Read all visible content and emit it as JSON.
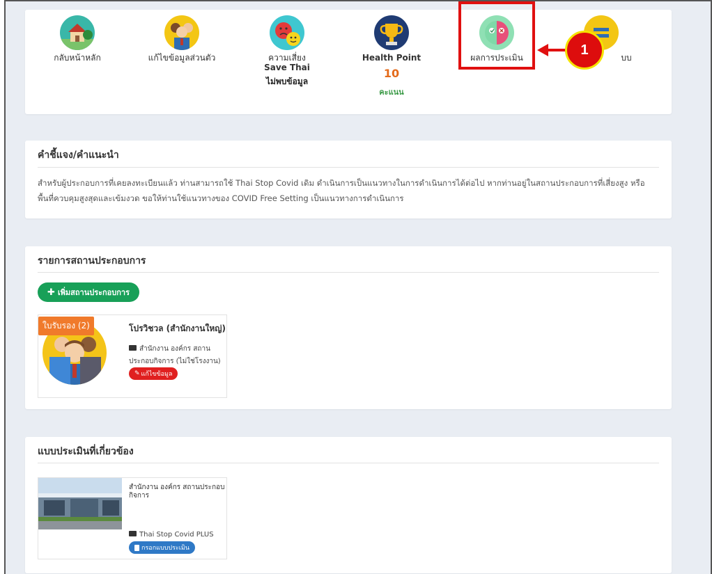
{
  "menu": {
    "home": "กลับหน้าหลัก",
    "profile": "แก้ไขข้อมูลส่วนตัว",
    "risk_line1": "ความเสี่ยง",
    "risk_line2": "Save Thai",
    "risk_status": "ไม่พบข้อมูล",
    "health_label": "Health Point",
    "health_score": "10",
    "health_unit": "คะแนน",
    "results": "ผลการประเมิน",
    "logout_partial": "บบ"
  },
  "callout": {
    "number": "1"
  },
  "guide": {
    "title": "คำชี้แจง/คำแนะนำ",
    "body": "สำหรับผู้ประกอบการที่เคยลงทะเบียนแล้ว ท่านสามารถใช้ Thai Stop Covid เดิม ดำเนินการเป็นแนวทางในการดำเนินการได้ต่อไป หากท่านอยู่ในสถานประกอบการที่เสี่ยงสูง หรือ พื้นที่ควบคุมสูงสุดและเข้มงวด ขอให้ท่านใช้แนวทางของ COVID Free Setting เป็นแนวทางการดำเนินการ"
  },
  "business": {
    "title": "รายการสถานประกอบการ",
    "add_label": "เพิ่มสถานประกอบการ",
    "card": {
      "cert": "ใบรับรอง (2)",
      "name": "โปรวิชวล (สำนักงานใหญ่)",
      "type": "สำนักงาน องค์กร สถานประกอบกิจการ (ไม่ใช่โรงงาน)",
      "edit": "แก้ไขข้อมูล"
    }
  },
  "assessment": {
    "title": "แบบประเมินที่เกี่ยวข้อง",
    "card": {
      "name": "สำนักงาน องค์กร สถานประกอบกิจการ",
      "type": "Thai Stop Covid PLUS",
      "fill": "กรอกแบบประเมิน"
    }
  }
}
